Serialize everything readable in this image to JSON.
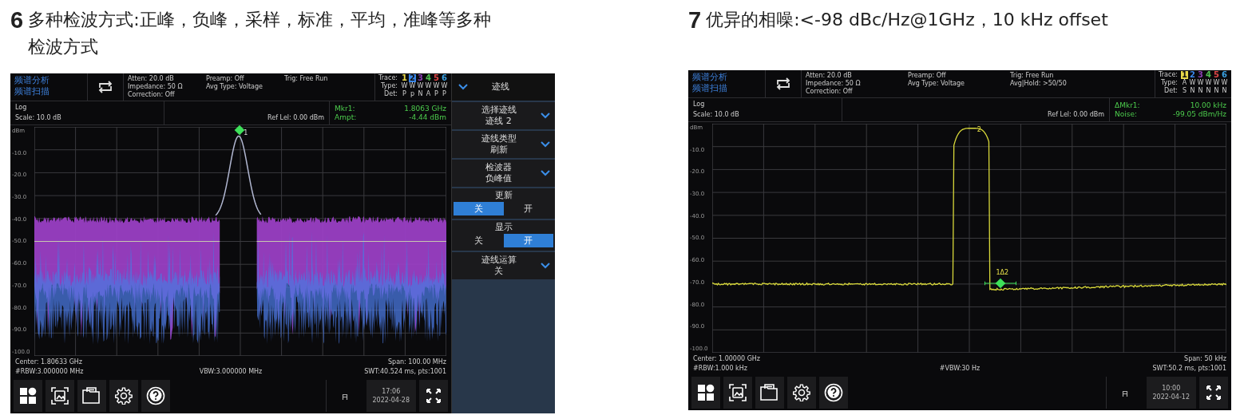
{
  "sections": [
    {
      "number": "6",
      "title": "多种检波方式:正峰，负峰，采样，标准，平均，准峰等多种检波方式",
      "screen": {
        "mode": [
          "频谱分析",
          "频谱扫描"
        ],
        "info": [
          [
            "Atten: 20.0 dB",
            "Impedance: 50 Ω",
            "Correction: Off"
          ],
          [
            "Preamp: Off",
            "Avg Type: Voltage"
          ],
          [
            "Trig: Free Run"
          ]
        ],
        "trace_labels": [
          "Trace:",
          "Type:",
          "Det:"
        ],
        "traces": [
          {
            "num": "1",
            "color": "#e8d84a",
            "selected": false,
            "type": "W",
            "det": "P"
          },
          {
            "num": "2",
            "color": "#3a86e8",
            "selected": true,
            "type": "W",
            "det": "p"
          },
          {
            "num": "3",
            "color": "#8a3fb0",
            "selected": false,
            "type": "W",
            "det": "N"
          },
          {
            "num": "4",
            "color": "#4fc04f",
            "selected": false,
            "type": "W",
            "det": "A"
          },
          {
            "num": "5",
            "color": "#e04848",
            "selected": false,
            "type": "W",
            "det": "P"
          },
          {
            "num": "6",
            "color": "#3aa0e0",
            "selected": false,
            "type": "W",
            "det": "P"
          }
        ],
        "scale": [
          "Log",
          "Scale: 10.0 dB"
        ],
        "ref": "Ref Lel: 0.00 dBm",
        "readout": [
          {
            "label": "Mkr1:",
            "value": "1.8063 GHz"
          },
          {
            "label": "Ampt:",
            "value": "-4.44 dBm"
          }
        ],
        "y_labels": [
          "dBm",
          "-10.0",
          "-20.0",
          "-30.0",
          "-40.0",
          "-50.0",
          "-60.0",
          "-70.0",
          "-80.0",
          "-90.0",
          "-100.0"
        ],
        "plot": {
          "kind": "noise",
          "markers": [
            "1"
          ]
        },
        "footer": {
          "center": "Center: 1.80633 GHz",
          "span": "Span: 100.00 MHz",
          "rbw": "#RBW:3.000000 MHz",
          "vbw": "VBW:3.000000 MHz",
          "swt": "SWT:40.524 ms, pts:1001"
        },
        "time": "17:06",
        "date": "2022-04-28",
        "softkeys": {
          "title": "迹线",
          "items": [
            {
              "kind": "dropdown",
              "label": "选择迹线",
              "value": "迹线 2"
            },
            {
              "kind": "dropdown",
              "label": "迹线类型",
              "value": "刷新"
            },
            {
              "kind": "dropdown",
              "label": "检波器",
              "value": "负峰值"
            },
            {
              "kind": "toggle",
              "label": "更新",
              "options": [
                {
                  "label": "关",
                  "selected": true
                },
                {
                  "label": "开",
                  "selected": false
                }
              ]
            },
            {
              "kind": "toggle",
              "label": "显示",
              "options": [
                {
                  "label": "关",
                  "selected": false
                },
                {
                  "label": "开",
                  "selected": true
                }
              ]
            },
            {
              "kind": "dropdown",
              "label": "迹线运算",
              "value": "关"
            }
          ]
        }
      }
    },
    {
      "number": "7",
      "title": "优异的相噪:<-98 dBc/Hz@1GHz，10 kHz offset",
      "screen": {
        "mode": [
          "频谱分析",
          "频谱扫描"
        ],
        "info": [
          [
            "Atten: 20.0 dB",
            "Impedance: 50 Ω",
            "Correction: Off"
          ],
          [
            "Preamp: Off",
            "Avg Type: Voltage"
          ],
          [
            "Trig: Free Run",
            "Avg|Hold: >50/50"
          ]
        ],
        "trace_labels": [
          "Trace:",
          "Type:",
          "Det:"
        ],
        "traces": [
          {
            "num": "1",
            "color": "#e8d84a",
            "selected": true,
            "type": "A",
            "det": "S"
          },
          {
            "num": "2",
            "color": "#3a86e8",
            "selected": false,
            "type": "W",
            "det": "N"
          },
          {
            "num": "3",
            "color": "#8a3fb0",
            "selected": false,
            "type": "W",
            "det": "N"
          },
          {
            "num": "4",
            "color": "#4fc04f",
            "selected": false,
            "type": "W",
            "det": "N"
          },
          {
            "num": "5",
            "color": "#e04848",
            "selected": false,
            "type": "W",
            "det": "N"
          },
          {
            "num": "6",
            "color": "#3aa0e0",
            "selected": false,
            "type": "W",
            "det": "N"
          }
        ],
        "scale": [
          "Log",
          "Scale: 10.0 dB"
        ],
        "ref": "Ref Lel: 0.00 dBm",
        "readout": [
          {
            "label": "ΔMkr1:",
            "value": "10.00 kHz"
          },
          {
            "label": "Noise:",
            "value": "-99.05 dBm/Hz"
          }
        ],
        "y_labels": [
          "dBm",
          "-10.0",
          "-20.0",
          "-30.0",
          "-40.0",
          "-50.0",
          "-60.0",
          "-70.0",
          "-80.0",
          "-90.0",
          "-100.0"
        ],
        "plot": {
          "kind": "phase_noise",
          "markers": [
            "2",
            "1Δ2"
          ]
        },
        "footer": {
          "center": "Center: 1.00000 GHz",
          "span": "Span: 50 kHz",
          "rbw": "#RBW:1.000 kHz",
          "vbw": "#VBW:30 Hz",
          "swt": "SWT:50.2 ms, pts:1001"
        },
        "time": "10:00",
        "date": "2022-04-12"
      }
    }
  ]
}
